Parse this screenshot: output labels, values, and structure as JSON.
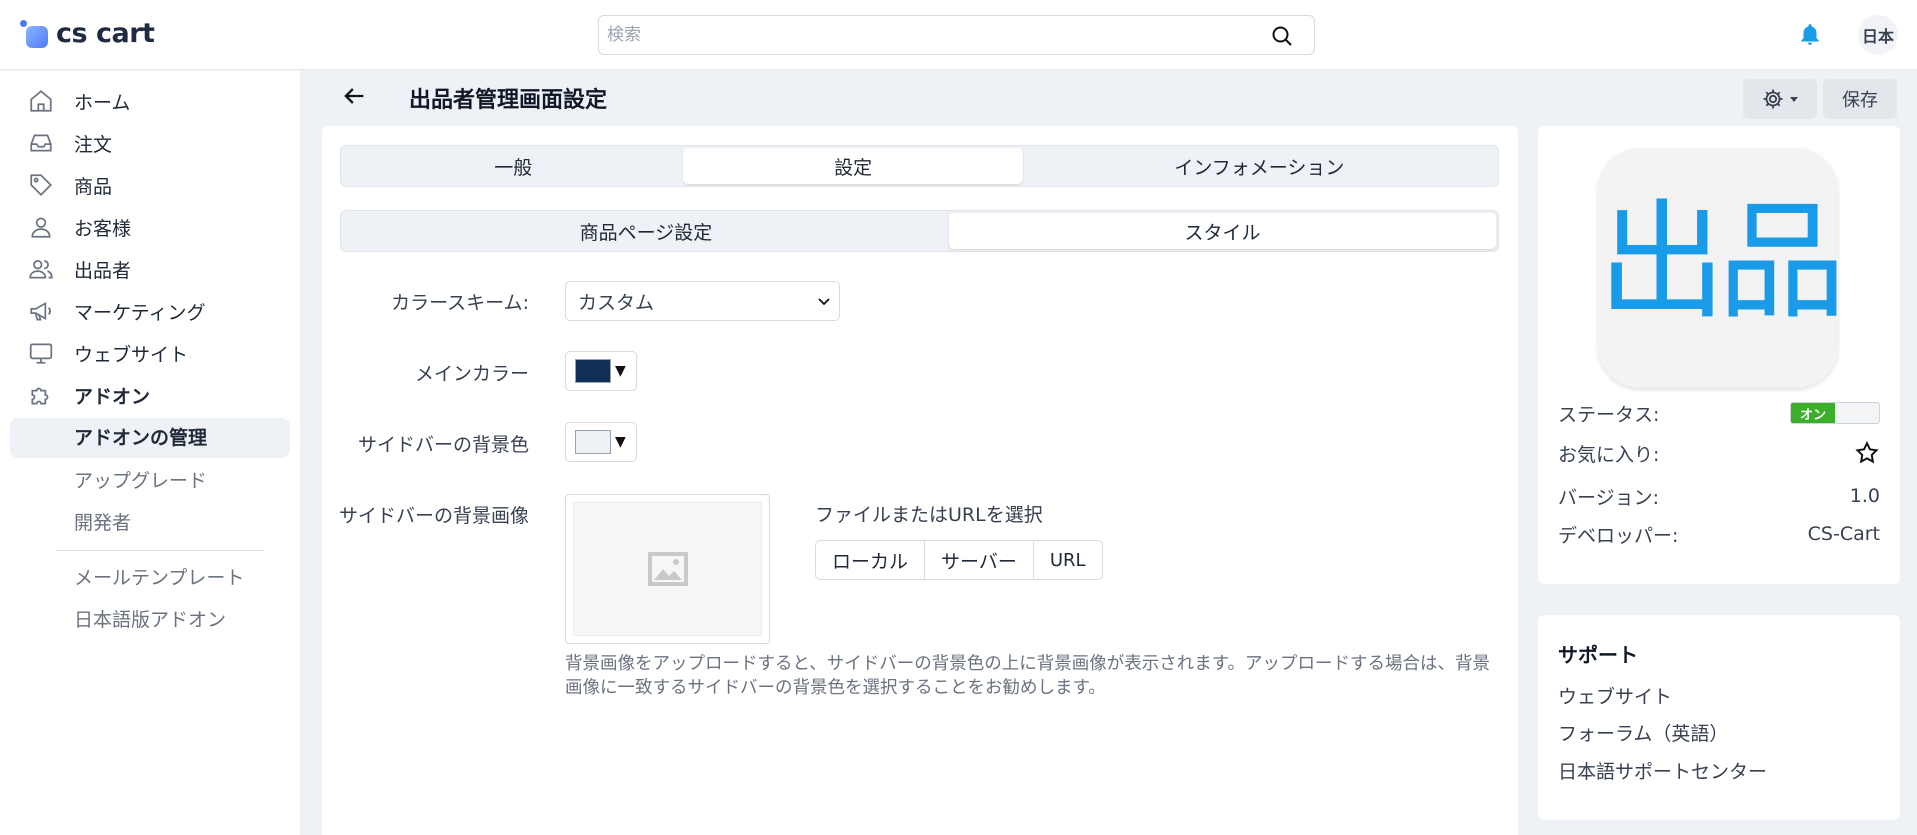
{
  "app": {
    "logo_text": "cs cart",
    "search_placeholder": "検索",
    "language_badge": "日本",
    "accent_color": "#1a9be8"
  },
  "sidebar": {
    "items": [
      {
        "label": "ホーム",
        "icon": "home-icon"
      },
      {
        "label": "注文",
        "icon": "inbox-icon"
      },
      {
        "label": "商品",
        "icon": "tag-icon"
      },
      {
        "label": "お客様",
        "icon": "user-icon"
      },
      {
        "label": "出品者",
        "icon": "users-icon"
      },
      {
        "label": "マーケティング",
        "icon": "megaphone-icon"
      },
      {
        "label": "ウェブサイト",
        "icon": "monitor-icon"
      },
      {
        "label": "アドオン",
        "icon": "puzzle-icon"
      }
    ],
    "sub_items": {
      "active": "アドオンの管理",
      "upgrade": "アップグレード",
      "developer": "開発者",
      "mail_templates": "メールテンプレート",
      "jp_addons": "日本語版アドオン"
    }
  },
  "header": {
    "title": "出品者管理画面設定",
    "save_label": "保存"
  },
  "tabs": {
    "primary": [
      {
        "label": "一般",
        "active": false
      },
      {
        "label": "設定",
        "active": true
      },
      {
        "label": "インフォメーション",
        "active": false
      }
    ],
    "secondary": [
      {
        "label": "商品ページ設定",
        "active": false
      },
      {
        "label": "スタイル",
        "active": true
      }
    ]
  },
  "form": {
    "color_scheme_label": "カラースキーム:",
    "color_scheme_value": "カスタム",
    "main_color_label": "メインカラー",
    "main_color_value": "#0f2f57",
    "sidebar_bg_label": "サイドバーの背景色",
    "sidebar_bg_value": "#eef1f5",
    "sidebar_bg_image_label": "サイドバーの背景画像",
    "file_select_label": "ファイルまたはURLを選択",
    "file_buttons": [
      "ローカル",
      "サーバー",
      "URL"
    ],
    "help_text": "背景画像をアップロードすると、サイドバーの背景色の上に背景画像が表示されます。アップロードする場合は、背景画像に一致するサイドバーの背景色を選択することをお勧めします。"
  },
  "info": {
    "logo_text": "出品",
    "status_label": "ステータス:",
    "status_toggle": "オン",
    "favorite_label": "お気に入り:",
    "version_label": "バージョン:",
    "version_value": "1.0",
    "developer_label": "デベロッパー:",
    "developer_value": "CS-Cart"
  },
  "support": {
    "title": "サポート",
    "links": [
      "ウェブサイト",
      "フォーラム（英語）",
      "日本語サポートセンター"
    ]
  }
}
